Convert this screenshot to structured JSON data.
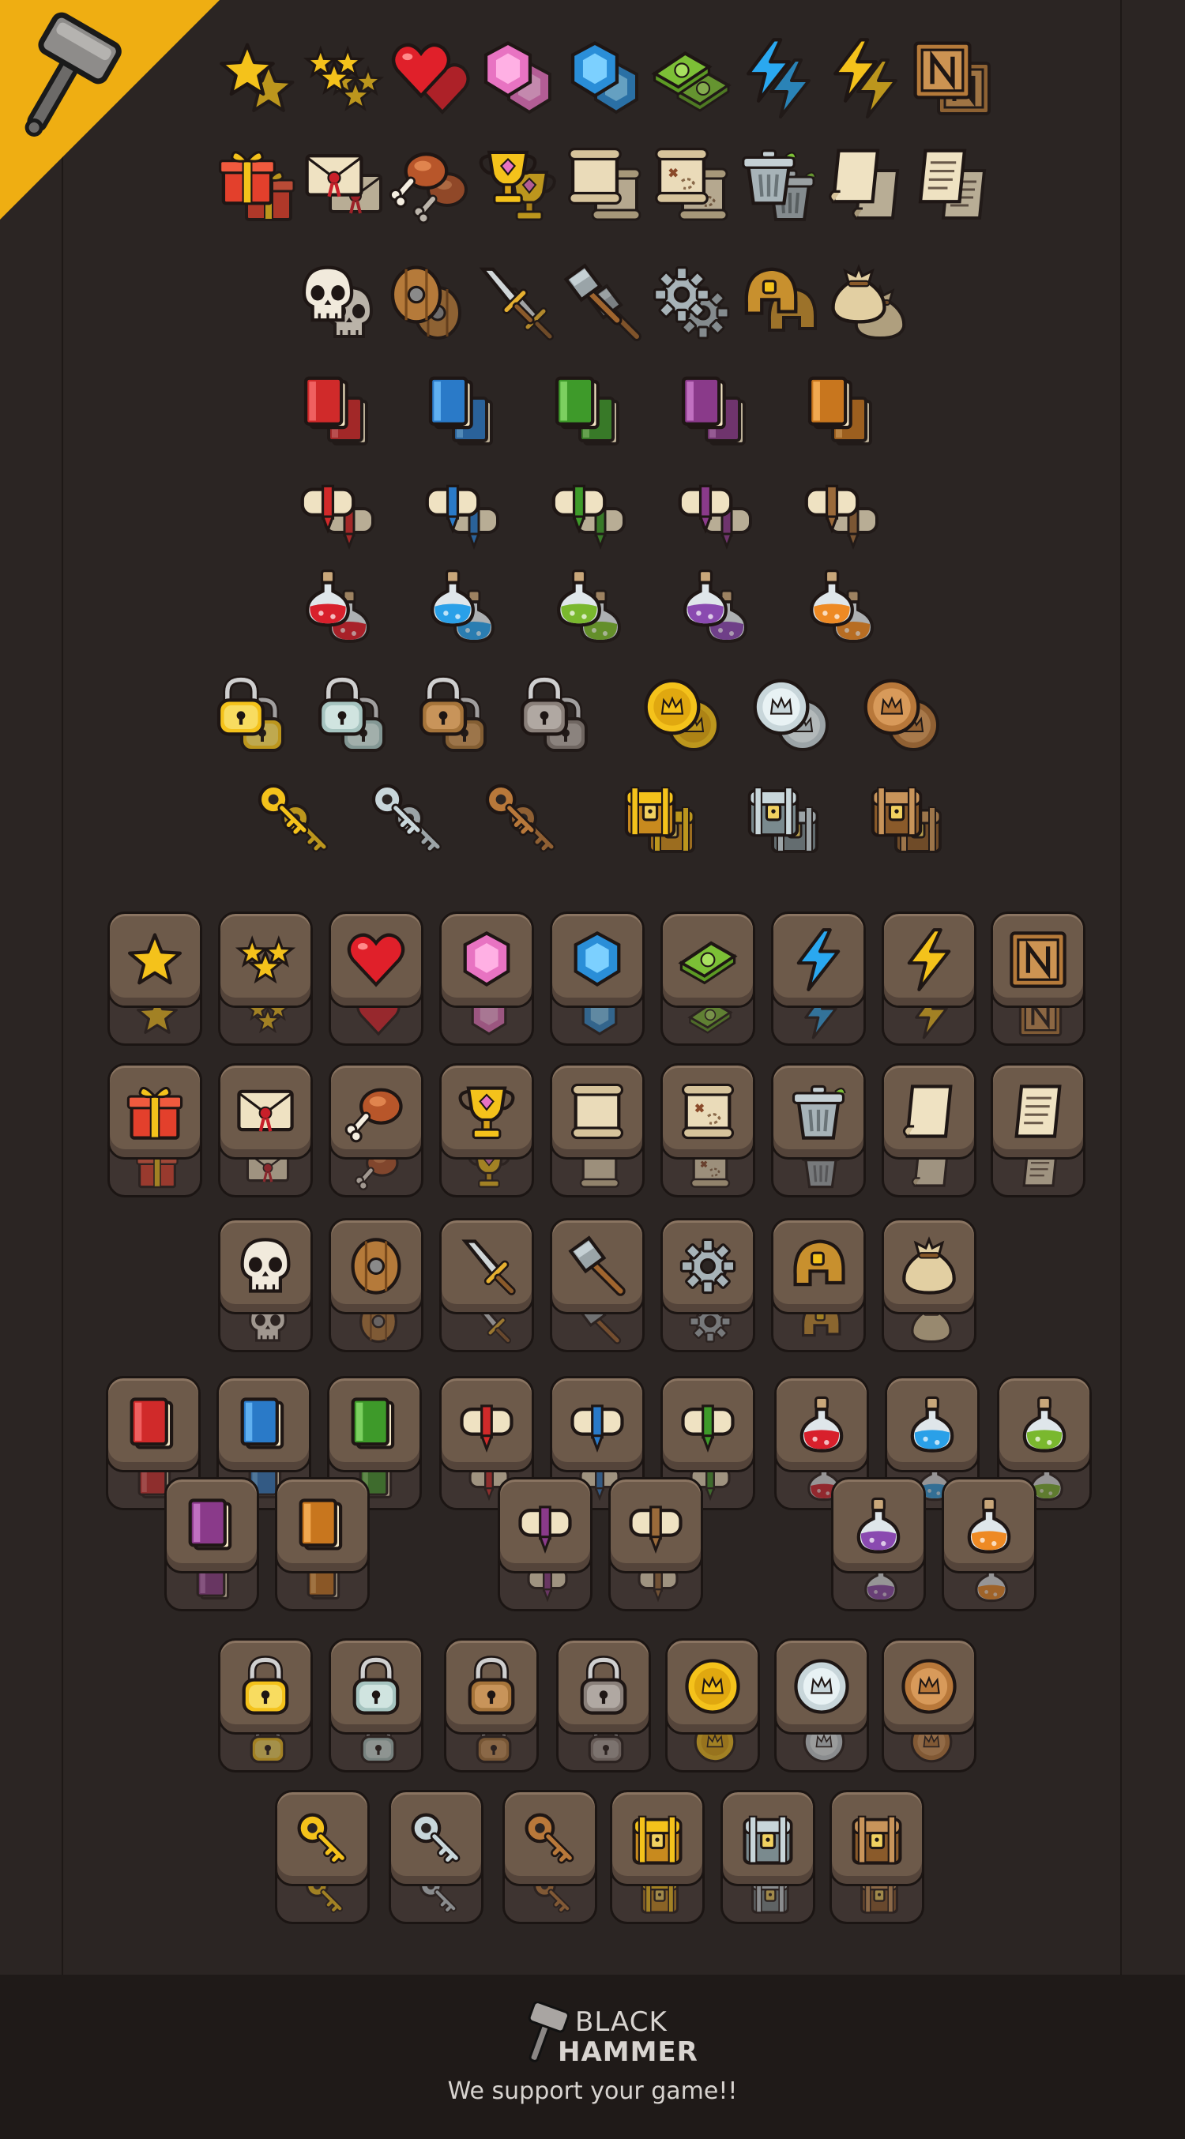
{
  "brand": {
    "name_top": "BLACK",
    "name_bottom": "HAMMER",
    "tagline": "We support your game!!"
  },
  "colors": {
    "background": "#2b2523",
    "footer": "#1f1a18",
    "corner": "#efae12",
    "tile_face": "#6d5a4a",
    "tile_base": "#3e3431"
  },
  "loose_icons": [
    "star-icon",
    "three-stars-icon",
    "heart-icon",
    "pink-gem-icon",
    "blue-gem-icon",
    "cash-icon",
    "blue-lightning-icon",
    "yellow-lightning-icon",
    "wooden-crate-icon",
    "gift-box-icon",
    "sealed-letter-icon",
    "meat-drumstick-icon",
    "trophy-icon",
    "scroll-icon",
    "treasure-map-icon",
    "trash-can-icon",
    "paper-scroll-icon",
    "written-scroll-icon",
    "skull-icon",
    "wooden-shield-icon",
    "sword-icon",
    "hammer-icon",
    "gear-icon",
    "helmet-icon",
    "loot-bag-icon",
    "red-book-icon",
    "blue-book-icon",
    "green-book-icon",
    "purple-book-icon",
    "orange-book-icon",
    "red-ribbon-scroll-icon",
    "blue-ribbon-scroll-icon",
    "green-ribbon-scroll-icon",
    "purple-ribbon-scroll-icon",
    "brown-ribbon-scroll-icon",
    "red-potion-icon",
    "blue-potion-icon",
    "green-potion-icon",
    "purple-potion-icon",
    "orange-potion-icon",
    "gold-lock-icon",
    "silver-lock-icon",
    "bronze-lock-icon",
    "iron-lock-icon",
    "gold-coin-icon",
    "silver-coin-icon",
    "bronze-coin-icon",
    "gold-key-icon",
    "silver-key-icon",
    "bronze-key-icon",
    "gold-chest-icon",
    "silver-chest-icon",
    "bronze-chest-icon"
  ],
  "tile_icons": [
    "star-icon",
    "three-stars-icon",
    "heart-icon",
    "pink-gem-icon",
    "blue-gem-icon",
    "cash-icon",
    "blue-lightning-icon",
    "yellow-lightning-icon",
    "wooden-crate-icon",
    "gift-box-icon",
    "sealed-letter-icon",
    "meat-drumstick-icon",
    "trophy-icon",
    "scroll-icon",
    "treasure-map-icon",
    "trash-can-icon",
    "paper-scroll-icon",
    "written-scroll-icon",
    "skull-icon",
    "wooden-shield-icon",
    "sword-icon",
    "hammer-icon",
    "gear-icon",
    "helmet-icon",
    "loot-bag-icon",
    "red-book-icon",
    "blue-book-icon",
    "green-book-icon",
    "red-ribbon-scroll-icon",
    "blue-ribbon-scroll-icon",
    "green-ribbon-scroll-icon",
    "red-potion-icon",
    "blue-potion-icon",
    "green-potion-icon",
    "purple-book-icon",
    "orange-book-icon",
    "purple-ribbon-scroll-icon",
    "brown-ribbon-scroll-icon",
    "purple-potion-icon",
    "orange-potion-icon",
    "gold-lock-icon",
    "silver-lock-icon",
    "bronze-lock-icon",
    "iron-lock-icon",
    "gold-coin-icon",
    "silver-coin-icon",
    "bronze-coin-icon",
    "gold-key-icon",
    "silver-key-icon",
    "bronze-key-icon",
    "gold-chest-icon",
    "silver-chest-icon",
    "bronze-chest-icon"
  ]
}
